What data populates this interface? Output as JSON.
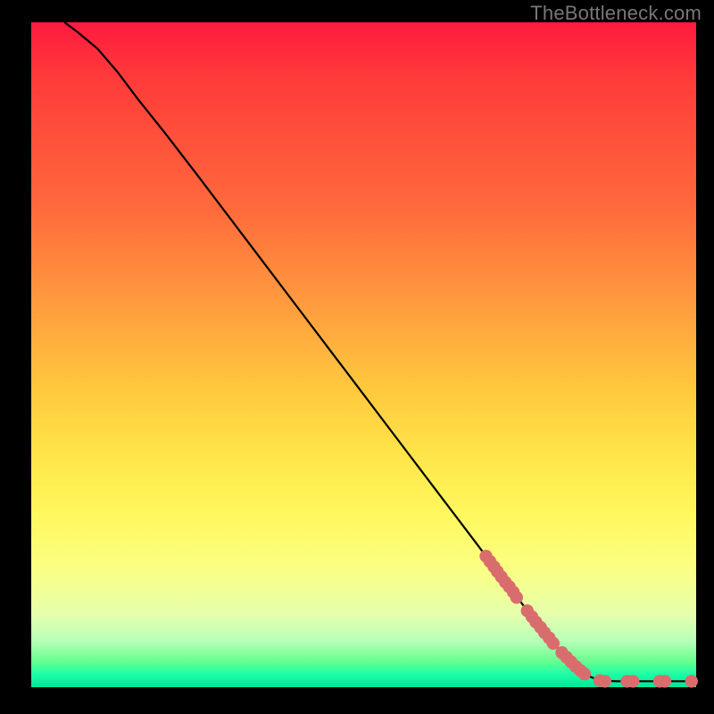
{
  "watermark": "TheBottleneck.com",
  "chart_data": {
    "type": "line",
    "title": "",
    "xlabel": "",
    "ylabel": "",
    "xlim": [
      0,
      100
    ],
    "ylim": [
      0,
      100
    ],
    "curve": [
      {
        "x": 5.0,
        "y": 100.0
      },
      {
        "x": 7.0,
        "y": 98.5
      },
      {
        "x": 10.0,
        "y": 96.0
      },
      {
        "x": 13.0,
        "y": 92.5
      },
      {
        "x": 16.0,
        "y": 88.5
      },
      {
        "x": 20.0,
        "y": 83.5
      },
      {
        "x": 25.0,
        "y": 77.0
      },
      {
        "x": 30.0,
        "y": 70.4
      },
      {
        "x": 35.0,
        "y": 63.8
      },
      {
        "x": 40.0,
        "y": 57.2
      },
      {
        "x": 45.0,
        "y": 50.6
      },
      {
        "x": 50.0,
        "y": 44.0
      },
      {
        "x": 55.0,
        "y": 37.4
      },
      {
        "x": 60.0,
        "y": 30.8
      },
      {
        "x": 65.0,
        "y": 24.2
      },
      {
        "x": 70.0,
        "y": 17.6
      },
      {
        "x": 75.0,
        "y": 11.0
      },
      {
        "x": 78.0,
        "y": 7.3
      },
      {
        "x": 80.0,
        "y": 5.0
      },
      {
        "x": 82.0,
        "y": 3.0
      },
      {
        "x": 84.0,
        "y": 1.6
      },
      {
        "x": 85.5,
        "y": 1.0
      },
      {
        "x": 88.0,
        "y": 0.9
      },
      {
        "x": 92.0,
        "y": 0.9
      },
      {
        "x": 96.0,
        "y": 0.9
      },
      {
        "x": 100.0,
        "y": 0.9
      }
    ],
    "markers": [
      {
        "x": 68.4,
        "y": 19.7
      },
      {
        "x": 69.0,
        "y": 18.9
      },
      {
        "x": 69.6,
        "y": 18.1
      },
      {
        "x": 70.1,
        "y": 17.4
      },
      {
        "x": 70.7,
        "y": 16.6
      },
      {
        "x": 71.3,
        "y": 15.8
      },
      {
        "x": 71.9,
        "y": 15.1
      },
      {
        "x": 72.5,
        "y": 14.3
      },
      {
        "x": 73.0,
        "y": 13.5
      },
      {
        "x": 74.6,
        "y": 11.5
      },
      {
        "x": 75.3,
        "y": 10.6
      },
      {
        "x": 75.9,
        "y": 9.8
      },
      {
        "x": 76.6,
        "y": 9.0
      },
      {
        "x": 77.2,
        "y": 8.2
      },
      {
        "x": 77.9,
        "y": 7.4
      },
      {
        "x": 78.5,
        "y": 6.6
      },
      {
        "x": 79.8,
        "y": 5.2
      },
      {
        "x": 80.5,
        "y": 4.5
      },
      {
        "x": 81.2,
        "y": 3.8
      },
      {
        "x": 81.9,
        "y": 3.1
      },
      {
        "x": 82.6,
        "y": 2.5
      },
      {
        "x": 83.2,
        "y": 2.0
      },
      {
        "x": 85.5,
        "y": 1.0
      },
      {
        "x": 86.3,
        "y": 0.9
      },
      {
        "x": 89.6,
        "y": 0.9
      },
      {
        "x": 90.5,
        "y": 0.9
      },
      {
        "x": 94.5,
        "y": 0.9
      },
      {
        "x": 95.3,
        "y": 0.9
      },
      {
        "x": 99.3,
        "y": 0.9
      }
    ]
  }
}
